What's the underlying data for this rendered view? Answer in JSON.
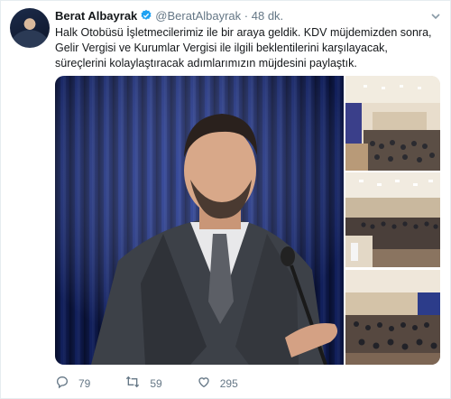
{
  "tweet": {
    "author_name": "Berat Albayrak",
    "handle": "@BeratAlbayrak",
    "separator": "·",
    "time": "48 dk.",
    "text": "Halk Otobüsü İşletmecilerimiz ile bir araya geldik. KDV müjdemizden sonra, Gelir Vergisi ve Kurumlar Vergisi ile ilgili beklentilerini karşılayacak, süreçlerini kolaylaştıracak adımlarımızın müjdesini paylaştık."
  },
  "actions": {
    "reply_count": "79",
    "retweet_count": "59",
    "like_count": "295"
  },
  "icons": {
    "verified": "verified-badge-icon",
    "menu": "chevron-down-icon",
    "reply": "reply-icon",
    "retweet": "retweet-icon",
    "like": "heart-icon"
  },
  "colors": {
    "verified": "#1da1f2",
    "meta_text": "#657786",
    "curtain": "#1a2c7a"
  }
}
